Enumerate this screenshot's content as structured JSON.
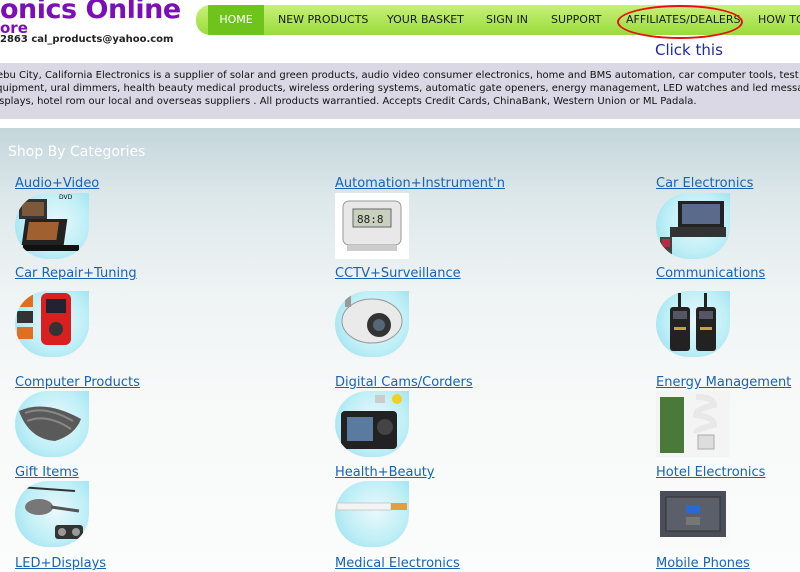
{
  "brand": {
    "name": "onics Online",
    "sub": "ore",
    "contact": "2863  cal_products@yahoo.com"
  },
  "nav": {
    "home": "HOME",
    "new_products": "NEW PRODUCTS",
    "basket": "YOUR BASKET",
    "sign_in": "SIGN IN",
    "support": "SUPPORT",
    "affiliates": "AFFILIATES/DEALERS",
    "how_to": "HOW TO"
  },
  "annotation": {
    "click_note": "Click this"
  },
  "description": "Cebu City, California Electronics is a supplier of solar and green products, audio video consumer electronics, home and BMS automation, car computer tools, test equipment, ural dimmers, health beauty medical products, wireless ordering systems, automatic gate openers, energy management, LED watches and led message displays, hotel rom our local and overseas suppliers . All products warrantied. Accepts Credit Cards, ChinaBank, Western Union or ML Padala.",
  "categories_heading": "Shop By  Categories",
  "categories": [
    {
      "label": "Audio+Video",
      "icon": "tv-dvd-icon"
    },
    {
      "label": "Automation+Instrument'n",
      "icon": "thermostat-icon"
    },
    {
      "label": "Car Electronics",
      "icon": "car-stereo-icon"
    },
    {
      "label": "Car Repair+Tuning",
      "icon": "diagnostic-scanner-icon"
    },
    {
      "label": "CCTV+Surveillance",
      "icon": "dome-camera-icon"
    },
    {
      "label": "Communications",
      "icon": "walkie-talkie-icon"
    },
    {
      "label": "Computer Products",
      "icon": "keyboard-cover-icon"
    },
    {
      "label": "Digital Cams/Corders",
      "icon": "digital-camera-icon"
    },
    {
      "label": "Energy Management",
      "icon": "cfl-bulb-icon"
    },
    {
      "label": "Gift Items",
      "icon": "rc-helicopter-icon"
    },
    {
      "label": "Health+Beauty",
      "icon": "e-cigarette-icon"
    },
    {
      "label": "Hotel Electronics",
      "icon": "safe-box-icon"
    },
    {
      "label": "LED+Displays",
      "icon": ""
    },
    {
      "label": "Medical Electronics",
      "icon": ""
    },
    {
      "label": "Mobile Phones",
      "icon": ""
    }
  ],
  "colors": {
    "brand": "#7a0fb8",
    "nav_green": "#98dc3a",
    "link": "#1763b5",
    "highlight": "#e81010"
  }
}
